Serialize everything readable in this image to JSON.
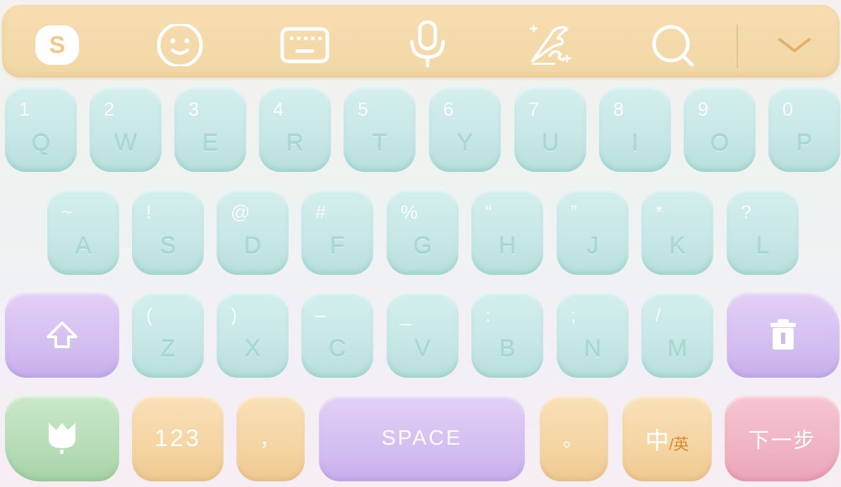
{
  "toolbar": {
    "icons": [
      "logo-s-icon",
      "emoji-icon",
      "keyboard-icon",
      "microphone-icon",
      "handwriting-quill-icon",
      "search-icon",
      "collapse-chevron-icon"
    ],
    "logo_letter": "S",
    "colors": {
      "bar": "#f2d7a6",
      "icon": "#ffffff"
    }
  },
  "keyboard": {
    "row1": [
      {
        "sub": "1",
        "main": "Q"
      },
      {
        "sub": "2",
        "main": "W"
      },
      {
        "sub": "3",
        "main": "E"
      },
      {
        "sub": "4",
        "main": "R"
      },
      {
        "sub": "5",
        "main": "T"
      },
      {
        "sub": "6",
        "main": "Y"
      },
      {
        "sub": "7",
        "main": "U"
      },
      {
        "sub": "8",
        "main": "I"
      },
      {
        "sub": "9",
        "main": "O"
      },
      {
        "sub": "0",
        "main": "P"
      }
    ],
    "row2": [
      {
        "sub": "~",
        "main": "A"
      },
      {
        "sub": "!",
        "main": "S"
      },
      {
        "sub": "@",
        "main": "D"
      },
      {
        "sub": "#",
        "main": "F"
      },
      {
        "sub": "%",
        "main": "G"
      },
      {
        "sub": "“",
        "main": "H"
      },
      {
        "sub": "”",
        "main": "J"
      },
      {
        "sub": "*",
        "main": "K"
      },
      {
        "sub": "?",
        "main": "L"
      }
    ],
    "row3": [
      {
        "sub": "(",
        "main": "Z"
      },
      {
        "sub": ")",
        "main": "X"
      },
      {
        "sub": "–",
        "main": "C"
      },
      {
        "sub": "_",
        "main": "V"
      },
      {
        "sub": ":",
        "main": "B"
      },
      {
        "sub": ";",
        "main": "N"
      },
      {
        "sub": "/",
        "main": "M"
      }
    ],
    "function_keys": {
      "shift_icon": "shift-arrow-icon",
      "delete_icon": "trash-delete-icon",
      "emoji_panel_icon": "tulip-icon",
      "numbers": "123",
      "comma": "，",
      "space": "SPACE",
      "period": "。",
      "lang_main": "中",
      "lang_sub": "/英",
      "next": "下一步"
    },
    "colors": {
      "letter_key": "#c8e8e6",
      "purple_key": "#d4bff1",
      "orange_key": "#f5d5a3",
      "green_key": "#b7ddb7",
      "pink_key": "#f0b4c4"
    }
  }
}
